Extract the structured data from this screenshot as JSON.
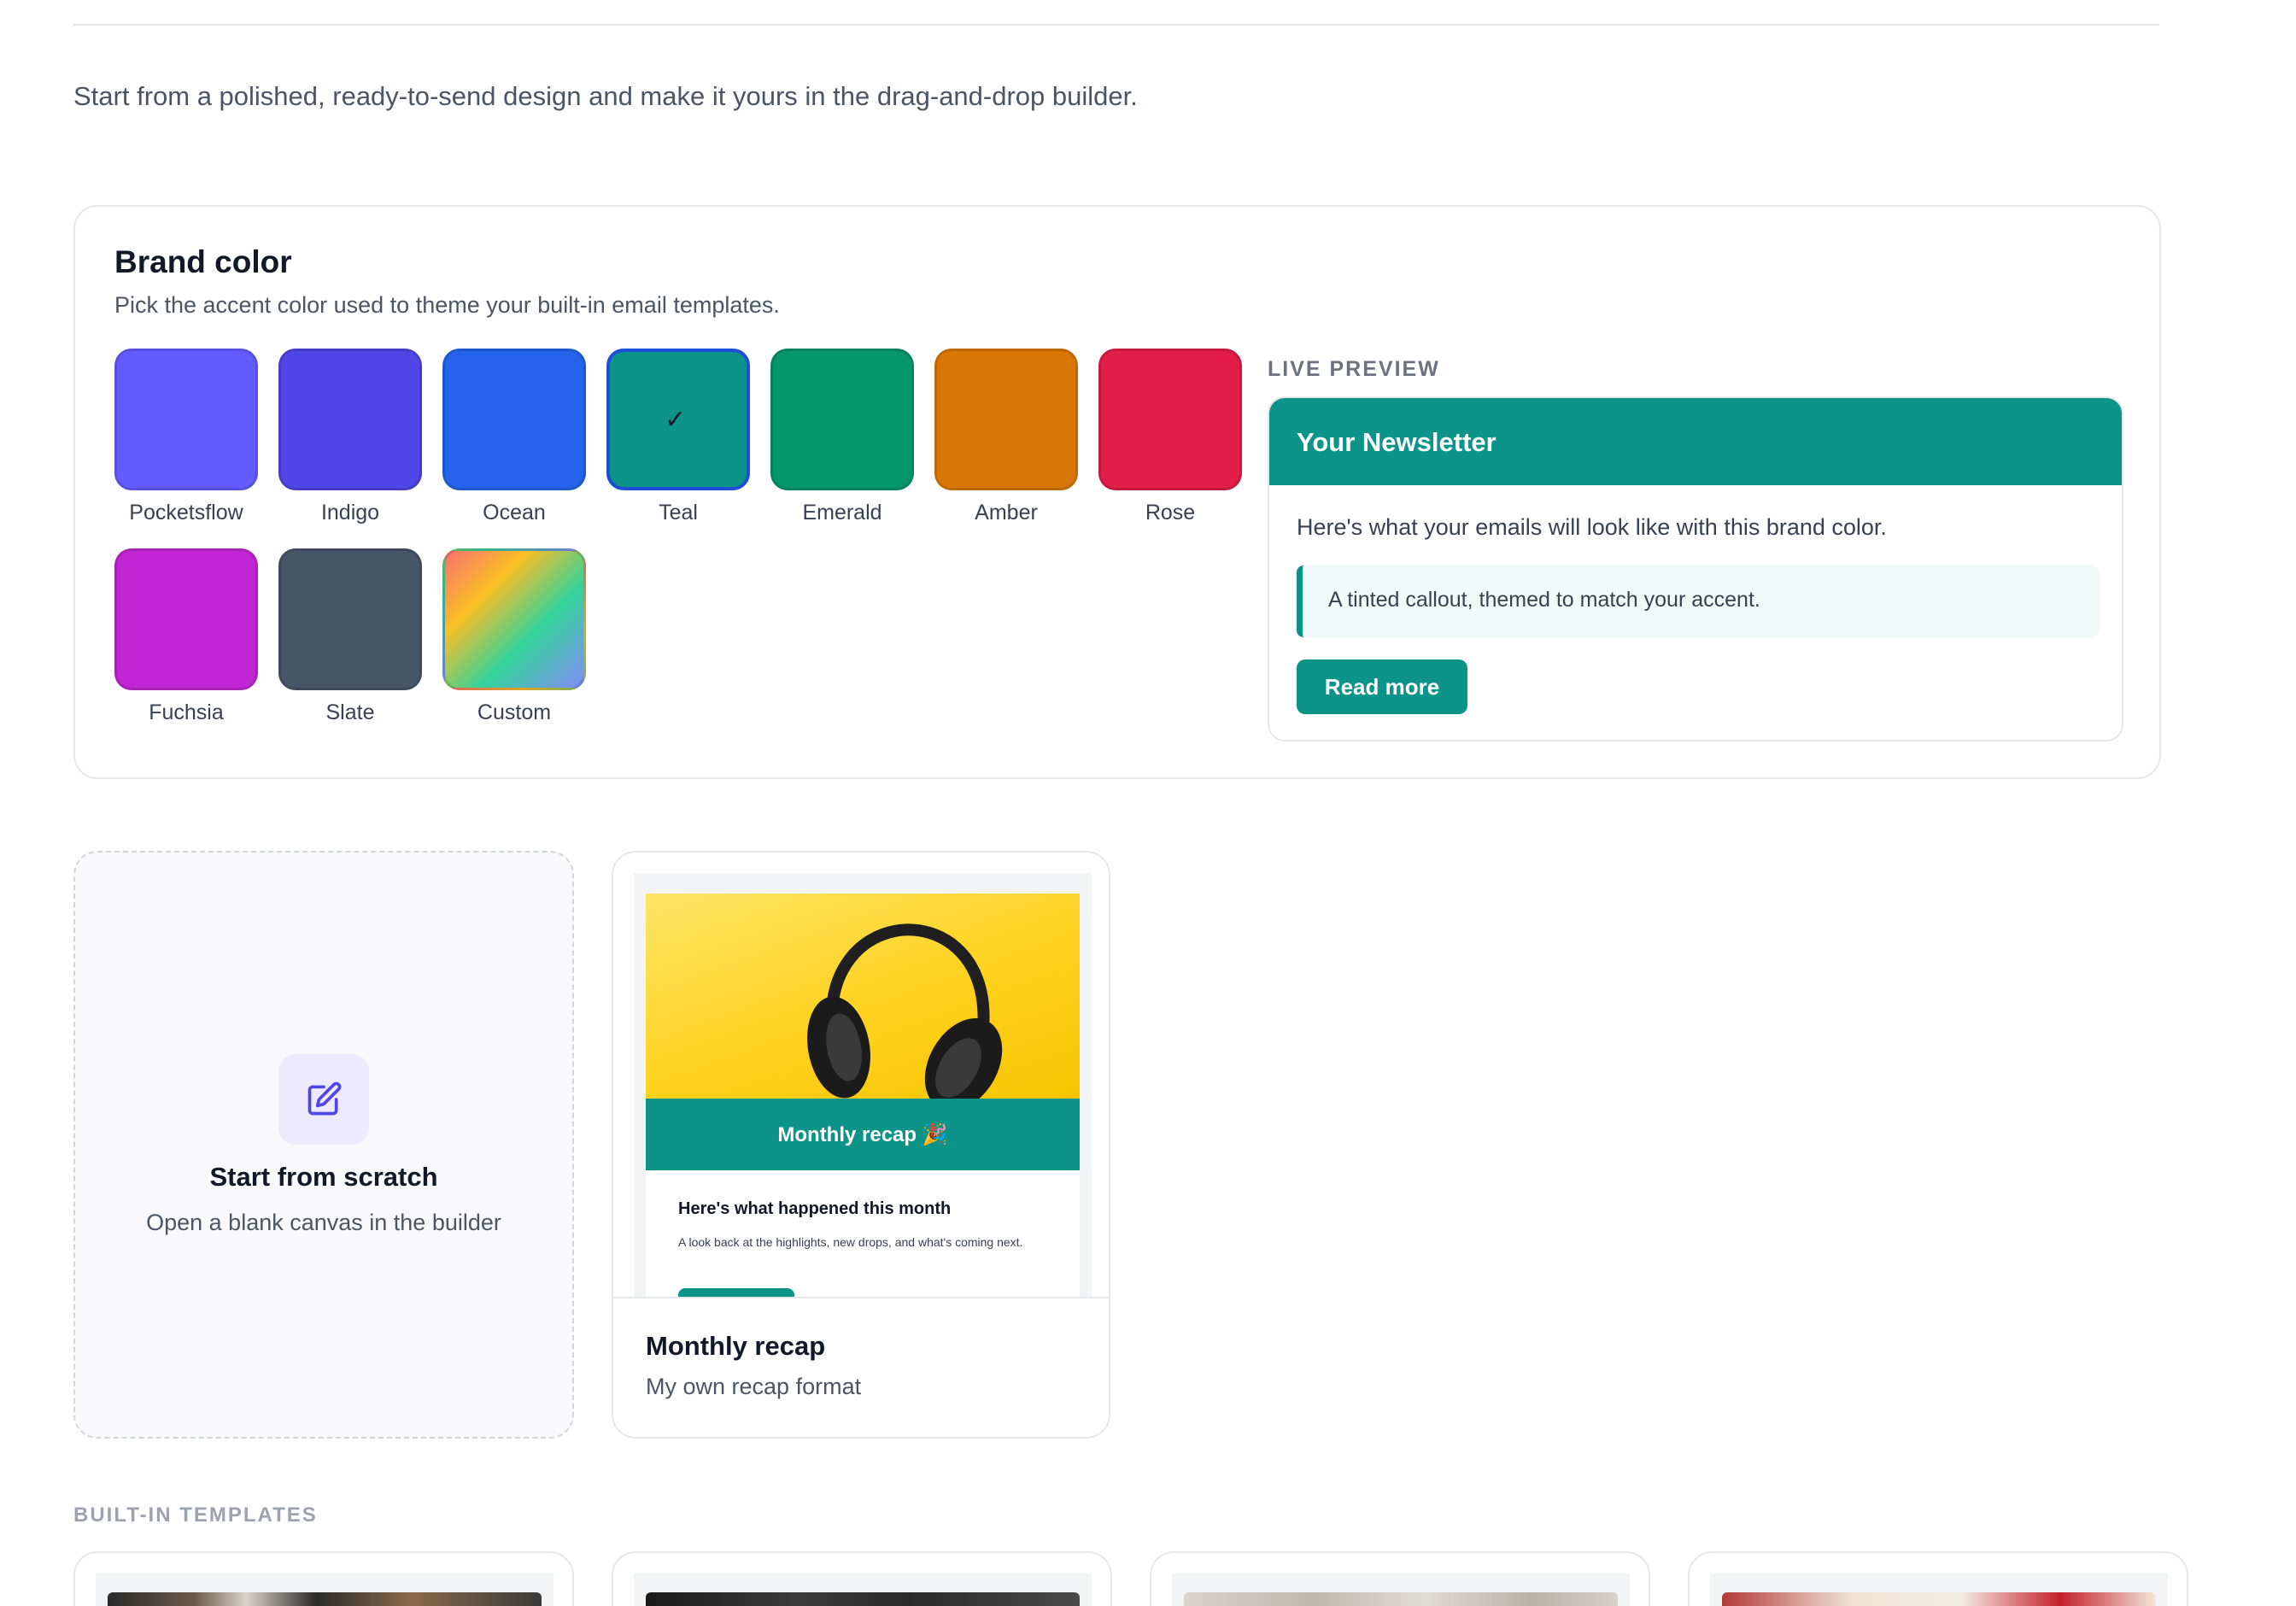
{
  "intro": {
    "text": "Start from a polished, ready-to-send design and make it yours in the drag-and-drop builder."
  },
  "brand": {
    "title": "Brand color",
    "subtitle": "Pick the accent color used to theme your built-in email templates.",
    "selected": "Teal",
    "swatches": [
      {
        "label": "Pocketsflow",
        "color": "#635bff"
      },
      {
        "label": "Indigo",
        "color": "#4f46e5"
      },
      {
        "label": "Ocean",
        "color": "#2563eb"
      },
      {
        "label": "Teal",
        "color": "#0d9488"
      },
      {
        "label": "Emerald",
        "color": "#059669"
      },
      {
        "label": "Amber",
        "color": "#d97706"
      },
      {
        "label": "Rose",
        "color": "#e11d48"
      },
      {
        "label": "Fuchsia",
        "color": "#c026d3"
      },
      {
        "label": "Slate",
        "color": "#475569"
      },
      {
        "label": "Custom",
        "color": "gradient"
      }
    ]
  },
  "preview": {
    "label": "LIVE PREVIEW",
    "header": "Your Newsletter",
    "body": "Here's what your emails will look like with this brand color.",
    "callout": "A tinted callout, themed to match your accent.",
    "button": "Read more",
    "accent": "#0d9488"
  },
  "scratch": {
    "icon": "edit-icon",
    "title": "Start from scratch",
    "subtitle": "Open a blank canvas in the builder"
  },
  "my_template": {
    "thumb_band": "Monthly recap 🎉",
    "thumb_heading": "Here's what happened this month",
    "thumb_text": "A look back at the highlights, new drops, and what's coming next.",
    "name": "Monthly recap",
    "subtitle": "My own recap format"
  },
  "builtin": {
    "label": "BUILT-IN TEMPLATES"
  }
}
